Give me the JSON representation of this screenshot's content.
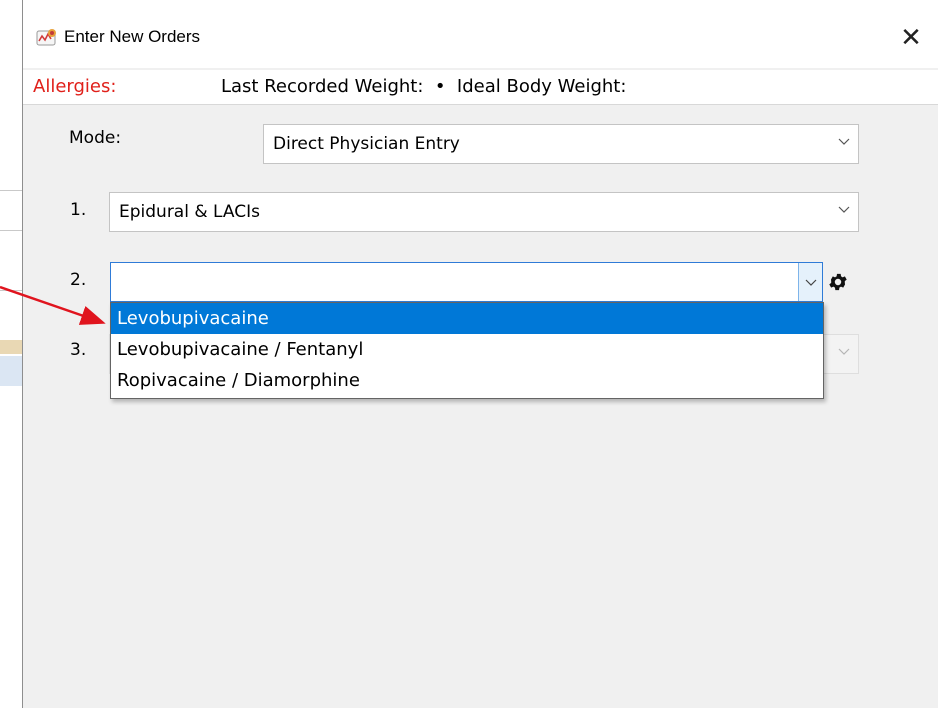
{
  "window": {
    "title": "Enter New Orders",
    "close_symbol": "✕",
    "icon": "app-logo-icon"
  },
  "info_bar": {
    "allergies_label": "Allergies:",
    "weight_text": "Last Recorded Weight:  •  Ideal Body Weight:"
  },
  "form": {
    "mode_label": "Mode:",
    "mode_value": "Direct Physician Entry",
    "row1_label": "1.",
    "row1_value": "Epidural & LACIs",
    "row2_label": "2.",
    "row2_value": "",
    "row3_label": "3.",
    "row3_value": ""
  },
  "dropdown": {
    "options": [
      "Levobupivacaine",
      "Levobupivacaine / Fentanyl",
      "Ropivacaine / Diamorphine"
    ],
    "highlighted_index": 0
  },
  "colors": {
    "allergies": "#e0201a",
    "highlight": "#0078d7",
    "annotation_arrow": "#e0141e"
  }
}
